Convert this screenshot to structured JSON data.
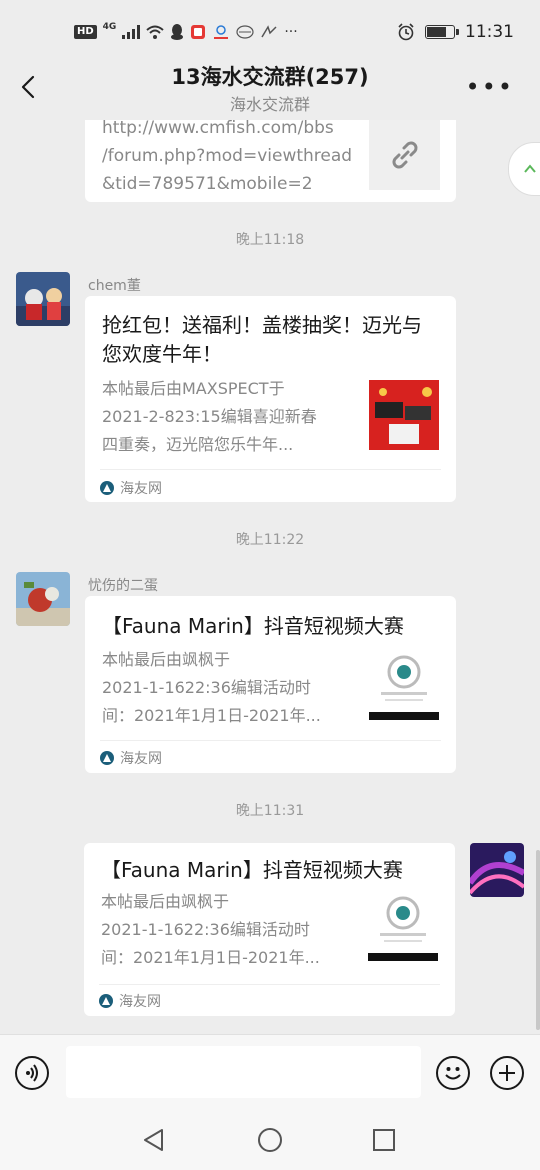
{
  "status_bar": {
    "network_badge": "HD",
    "network_type": "4G",
    "time": "11:31",
    "battery_level_pct": 75
  },
  "header": {
    "title": "13海水交流群(257)",
    "subtitle": "海水交流群"
  },
  "messages": [
    {
      "type": "link-partial",
      "url_lines": [
        "http://www.cmfish.com/bbs",
        "/forum.php?mod=viewthread",
        "&tid=789571&mobile=2"
      ]
    },
    {
      "time": "晚上11:18",
      "sender": "chem董",
      "title": "抢红包！送福利！盖楼抽奖！迈光与您欢度牛年！",
      "desc_lines": [
        "本帖最后由MAXSPECT于",
        "2021-2-823:15编辑喜迎新春",
        "四重奏，迈光陪您乐牛年..."
      ],
      "source": "海友网"
    },
    {
      "time": "晚上11:22",
      "sender": "忧伤的二蛋",
      "title": "【Fauna Marin】抖音短视频大赛",
      "desc_lines": [
        "本帖最后由飒枫于",
        "2021-1-1622:36编辑活动时",
        "间：2021年1月1日-2021年..."
      ],
      "source": "海友网"
    },
    {
      "time": "晚上11:31",
      "sender": "",
      "title": "【Fauna Marin】抖音短视频大赛",
      "desc_lines": [
        "本帖最后由飒枫于",
        "2021-1-1622:36编辑活动时",
        "间：2021年1月1日-2021年..."
      ],
      "source": "海友网"
    }
  ],
  "input_bar": {
    "placeholder": ""
  },
  "colors": {
    "background": "#ededed",
    "card": "#ffffff",
    "secondary_text": "#888888"
  }
}
